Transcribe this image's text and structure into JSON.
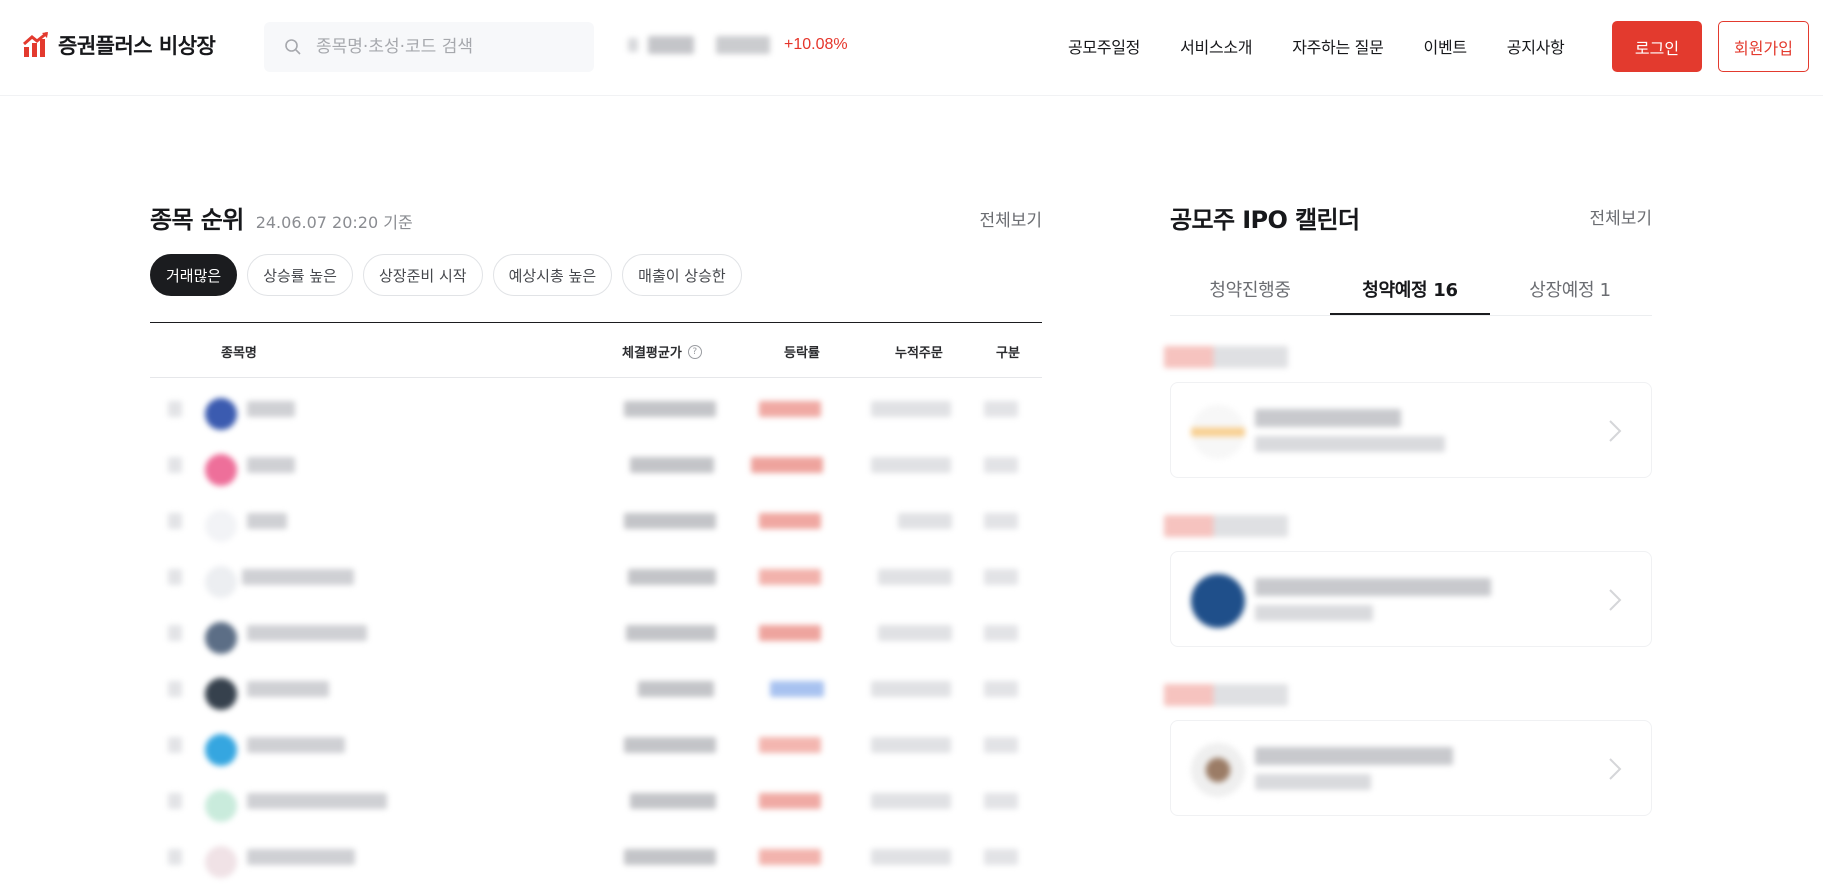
{
  "header": {
    "brand": "증권플러스 비상장",
    "search_placeholder": "종목명·초성·코드 검색",
    "ticker_change": "+10.08%",
    "nav": [
      "공모주일정",
      "서비스소개",
      "자주하는 질문",
      "이벤트",
      "공지사항"
    ],
    "login_label": "로그인",
    "signup_label": "회원가입"
  },
  "ranking": {
    "title": "종목 순위",
    "timestamp": "24.06.07 20:20 기준",
    "see_all": "전체보기",
    "chips": [
      "거래많은",
      "상승률 높은",
      "상장준비 시작",
      "예상시총 높은",
      "매출이 상승한"
    ],
    "active_chip": "거래많은",
    "columns": {
      "name": "종목명",
      "price": "체결평균가",
      "price_info": "?",
      "change": "등락률",
      "orders": "누적주문",
      "type": "구분"
    }
  },
  "ipo": {
    "title": "공모주 IPO 캘린더",
    "see_all": "전체보기",
    "tabs": [
      "청약진행중",
      "청약예정 16",
      "상장예정 1"
    ],
    "active_tab": "청약예정 16"
  },
  "colors": {
    "brand_red": "#e33a2e",
    "rise_red": "#e5352a",
    "fall_blue": "#6f97e6",
    "text_dark": "#17181b"
  },
  "icons": {
    "logo": "stock-chart-icon",
    "search": "search-icon",
    "info": "info-icon",
    "chevron": "chevron-right-icon"
  }
}
